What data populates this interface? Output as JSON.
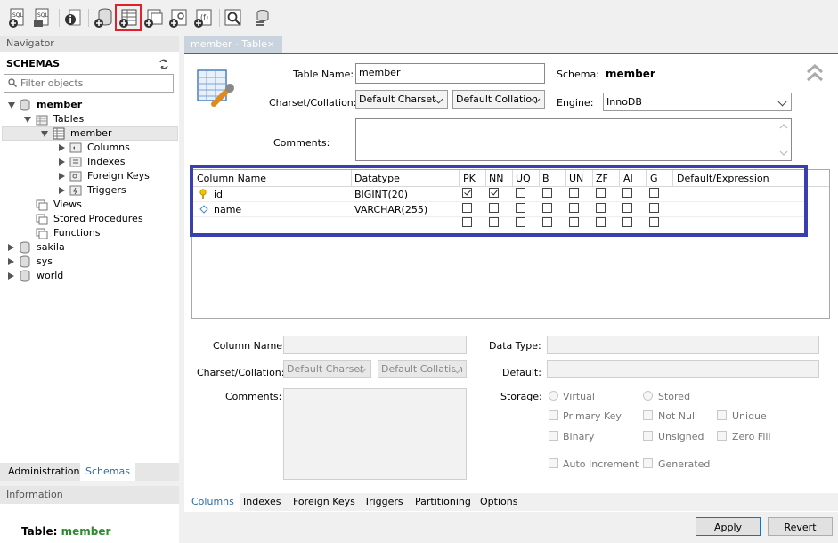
{
  "navigator": {
    "title": "Navigator",
    "schemas_title": "SCHEMAS",
    "filter_placeholder": "Filter objects",
    "tree": {
      "member": "member",
      "tables": "Tables",
      "member_table": "member",
      "columns": "Columns",
      "indexes": "Indexes",
      "foreign_keys": "Foreign Keys",
      "triggers": "Triggers",
      "views": "Views",
      "stored_procedures": "Stored Procedures",
      "functions": "Functions",
      "sakila": "sakila",
      "sys": "sys",
      "world": "world"
    },
    "tabs": [
      "Administration",
      "Schemas"
    ],
    "information_title": "Information",
    "info_label": "Table:",
    "info_value": "member"
  },
  "editor": {
    "tab_title": "member - Table",
    "tab_close": "×",
    "table_name_label": "Table Name:",
    "table_name_value": "member",
    "schema_label": "Schema:",
    "schema_value": "member",
    "charset_label": "Charset/Collation:",
    "charset_value": "Default Charset",
    "collation_value": "Default Collation",
    "engine_label": "Engine:",
    "engine_value": "InnoDB",
    "comments_label": "Comments:",
    "comments_value": ""
  },
  "grid": {
    "headers": [
      "Column Name",
      "Datatype",
      "PK",
      "NN",
      "UQ",
      "B",
      "UN",
      "ZF",
      "AI",
      "G",
      "Default/Expression"
    ],
    "rows": [
      {
        "name": "id",
        "datatype": "BIGINT(20)",
        "flags": [
          true,
          true,
          false,
          false,
          false,
          false,
          false,
          false
        ],
        "default": "",
        "icon": "key-icon"
      },
      {
        "name": "name",
        "datatype": "VARCHAR(255)",
        "flags": [
          false,
          false,
          false,
          false,
          false,
          false,
          false,
          false
        ],
        "default": "",
        "icon": "diamond-icon"
      },
      {
        "name": "",
        "datatype": "",
        "flags": [
          false,
          false,
          false,
          false,
          false,
          false,
          false,
          false
        ],
        "default": "",
        "icon": ""
      }
    ]
  },
  "details": {
    "column_name_label": "Column Name:",
    "data_type_label": "Data Type:",
    "charset_label": "Charset/Collation:",
    "charset_value": "Default Charset",
    "collation_value": "Default Collation",
    "default_label": "Default:",
    "comments_label": "Comments:",
    "storage_label": "Storage:",
    "virtual": "Virtual",
    "stored": "Stored",
    "primary_key": "Primary Key",
    "not_null": "Not Null",
    "unique": "Unique",
    "binary": "Binary",
    "unsigned": "Unsigned",
    "zero_fill": "Zero Fill",
    "auto_increment": "Auto Increment",
    "generated": "Generated"
  },
  "bottom_tabs": [
    "Columns",
    "Indexes",
    "Foreign Keys",
    "Triggers",
    "Partitioning",
    "Options"
  ],
  "buttons": {
    "apply": "Apply",
    "revert": "Revert"
  }
}
